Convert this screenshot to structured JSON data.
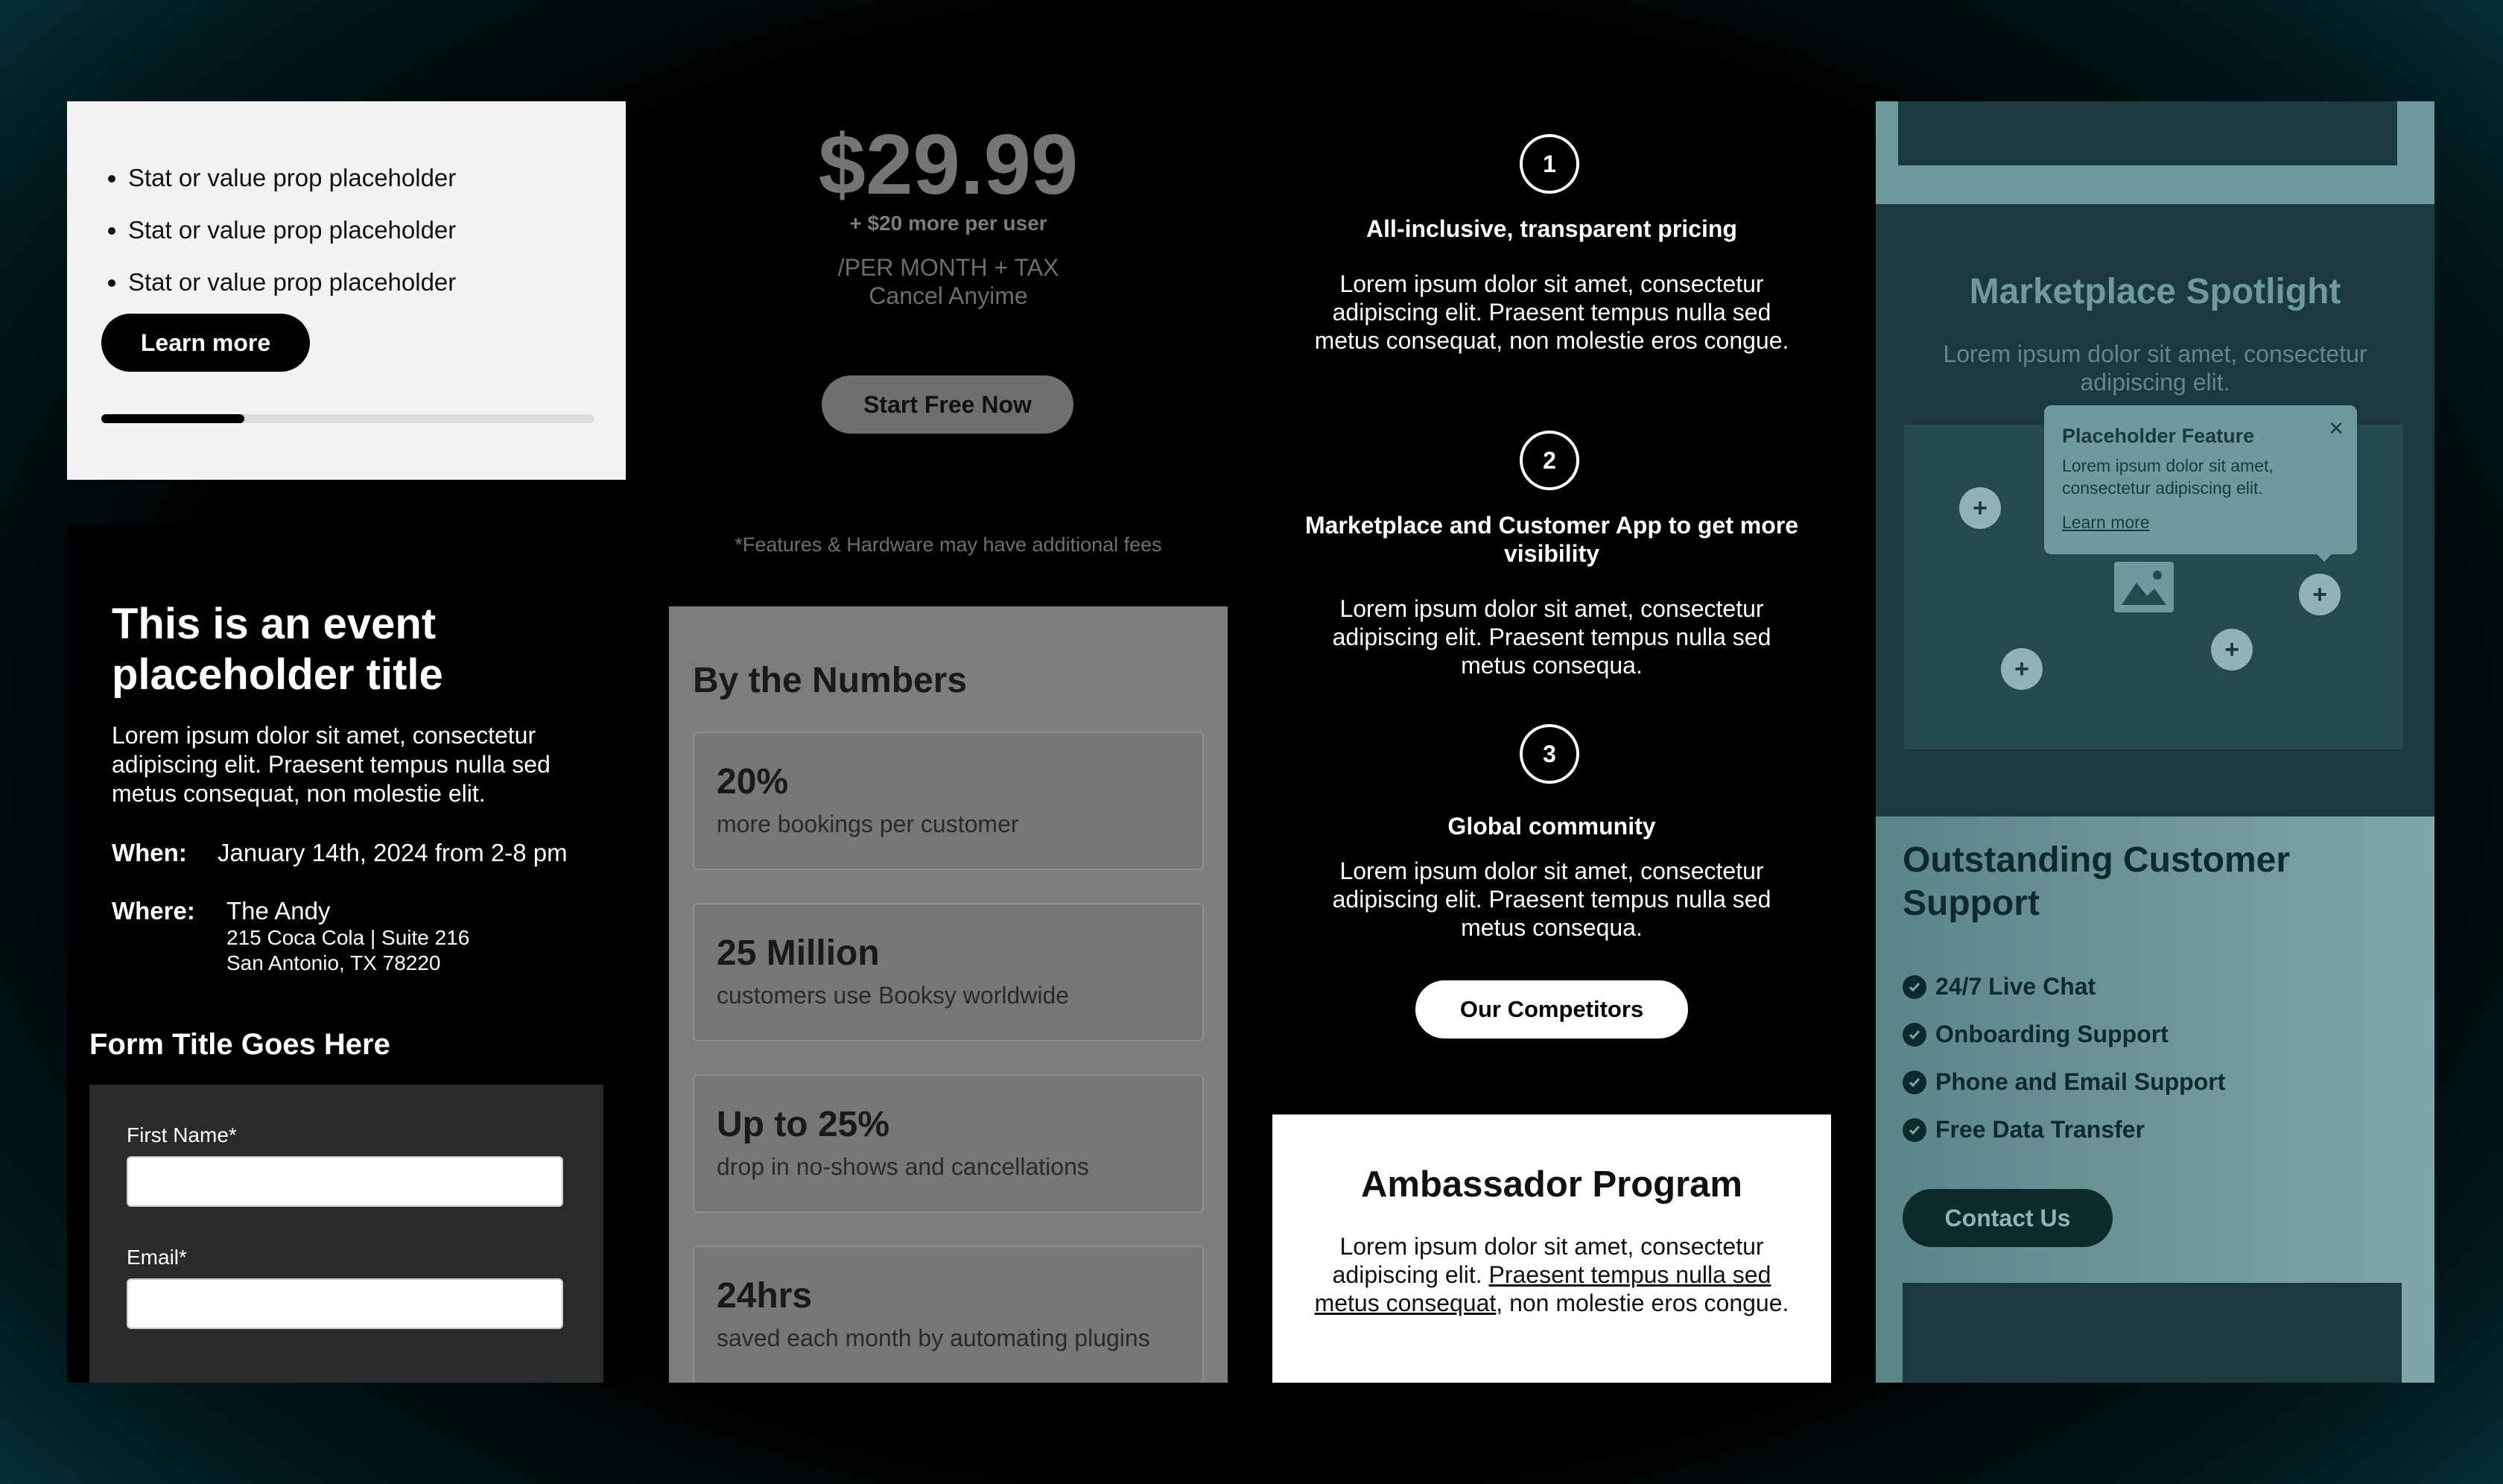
{
  "stats_card": {
    "items": [
      "Stat or value prop placeholder",
      "Stat or value prop placeholder",
      "Stat or value prop placeholder"
    ],
    "button_label": "Learn more",
    "progress": 0.29
  },
  "event": {
    "title": "This is an event placeholder title",
    "description": "Lorem ipsum dolor sit amet, consectetur adipiscing elit. Praesent tempus nulla sed metus consequat, non molestie elit.",
    "when_label": "When:",
    "when_value": "January 14th, 2024 from 2-8 pm",
    "where_label": "Where:",
    "where_name": "The Andy",
    "where_address1": "215 Coca Cola | Suite 216",
    "where_address2": "San Antonio, TX 78220",
    "form_title": "Form Title Goes Here",
    "first_name_label": "First Name*",
    "email_label": "Email*"
  },
  "pricing": {
    "price": "$29.99",
    "per_user": "+ $20 more per user",
    "per_month": "/PER MONTH + TAX",
    "cancel": "Cancel Anyime",
    "cta": "Start Free Now",
    "fees_note": "*Features & Hardware may have additional fees"
  },
  "numbers": {
    "heading": "By the Numbers",
    "stats": [
      {
        "value": "20%",
        "label": "more bookings per customer"
      },
      {
        "value": "25 Million",
        "label": "customers use Booksy worldwide"
      },
      {
        "value": "Up to 25%",
        "label": "drop in no-shows and cancellations"
      },
      {
        "value": "24hrs",
        "label": "saved each month by automating plugins"
      }
    ]
  },
  "features": {
    "items": [
      {
        "num": "1",
        "title": "All-inclusive, transparent pricing",
        "desc": "Lorem ipsum dolor sit amet, consectetur adipiscing elit. Praesent tempus nulla sed metus consequat, non molestie eros congue."
      },
      {
        "num": "2",
        "title": "Marketplace and Customer App to get more visibility",
        "desc": "Lorem ipsum dolor sit amet, consectetur adipiscing elit. Praesent tempus nulla sed metus consequa."
      },
      {
        "num": "3",
        "title": "Global community",
        "desc": "Lorem ipsum dolor sit amet, consectetur adipiscing elit. Praesent tempus nulla sed metus consequa."
      }
    ],
    "button_label": "Our Competitors"
  },
  "ambassador": {
    "title": "Ambassador Program",
    "desc_start": "Lorem ipsum dolor sit amet, consectetur adipiscing elit. ",
    "desc_link": "Praesent tempus nulla sed metus consequat",
    "desc_end": ", non molestie eros congue."
  },
  "spotlight": {
    "heading": "Marketplace Spotlight",
    "sub": "Lorem ipsum dolor sit amet, consectetur adipiscing elit.",
    "tooltip_title": "Placeholder Feature",
    "tooltip_body": "Lorem ipsum dolor sit amet, consectetur adipiscing elit.",
    "tooltip_link": "Learn more",
    "hotspot_glyph": "+",
    "close_glyph": "×",
    "image_icon": "image-icon"
  },
  "support": {
    "heading": "Outstanding Customer Support",
    "items": [
      "24/7 Live Chat",
      "Onboarding Support",
      "Phone and Email Support",
      "Free Data Transfer"
    ],
    "button_label": "Contact Us"
  },
  "colors": {
    "teal_dark": "#1a3a3d",
    "teal_light": "#6f9a9d",
    "background_edge": "#0b4e56"
  }
}
